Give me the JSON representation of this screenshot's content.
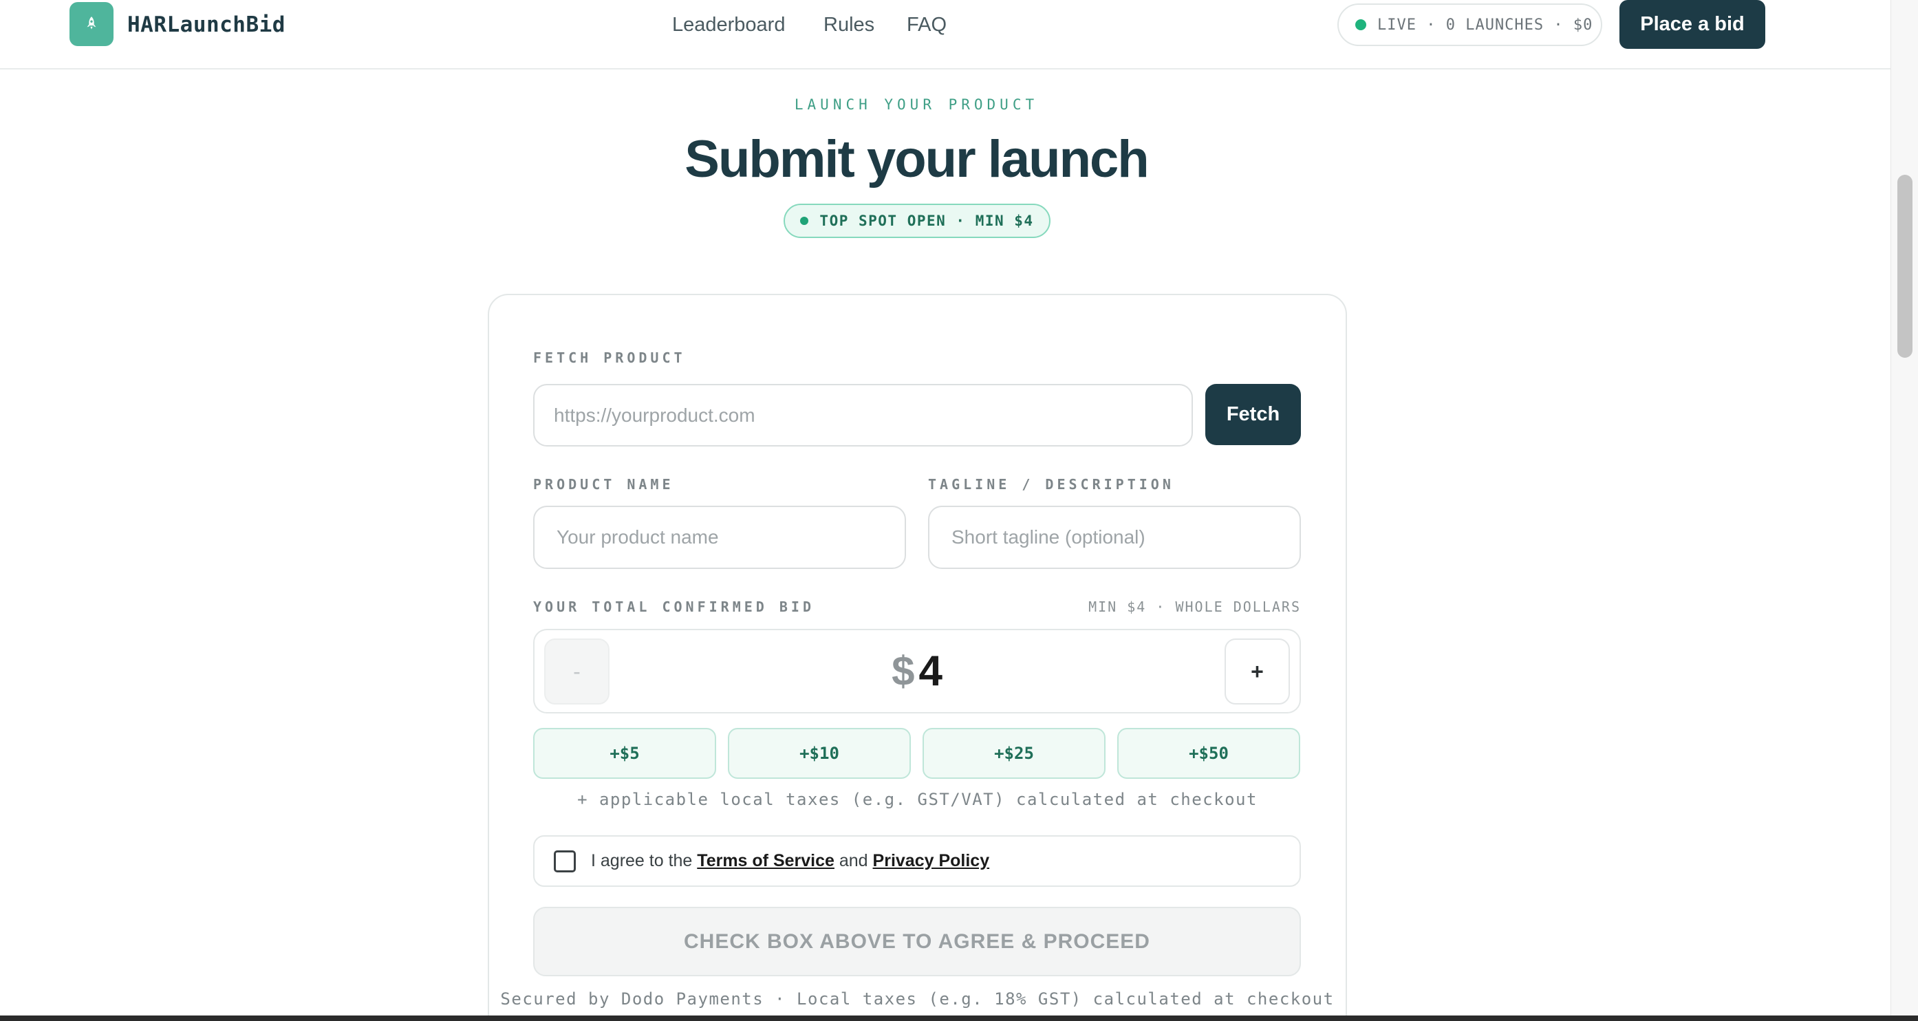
{
  "header": {
    "brand": "HARLaunchBid",
    "nav": [
      "Leaderboard",
      "Rules",
      "FAQ"
    ],
    "status": "LIVE · 0 LAUNCHES · $0",
    "cta": "Place a bid",
    "accent": "#4fb59c",
    "primary": "#1d3b46"
  },
  "hero": {
    "eyebrow": "LAUNCH YOUR PRODUCT",
    "title": "Submit your launch",
    "badge": "TOP SPOT OPEN · MIN $4"
  },
  "form": {
    "fetch_label": "FETCH PRODUCT",
    "url_placeholder": "https://yourproduct.com",
    "fetch_button": "Fetch",
    "name_label": "PRODUCT NAME",
    "name_placeholder": "Your product name",
    "tagline_label": "TAGLINE / DESCRIPTION",
    "tagline_placeholder": "Short tagline (optional)",
    "bid_label": "YOUR TOTAL CONFIRMED BID",
    "bid_hint": "MIN $4 · WHOLE DOLLARS",
    "minus": "-",
    "plus": "+",
    "currency": "$",
    "amount": "4",
    "quick_adds": [
      "+$5",
      "+$10",
      "+$25",
      "+$50"
    ],
    "tax_note": "+ applicable local taxes (e.g. GST/VAT) calculated at checkout",
    "agree_prefix": "I agree to the",
    "terms": "Terms of Service",
    "and": "and",
    "privacy": "Privacy Policy",
    "proceed": "CHECK BOX ABOVE TO AGREE & PROCEED",
    "secured": "Secured by Dodo Payments · Local taxes (e.g. 18% GST) calculated at checkout"
  },
  "icons": {
    "logo": "rocket-icon",
    "status": "live-dot-icon"
  }
}
